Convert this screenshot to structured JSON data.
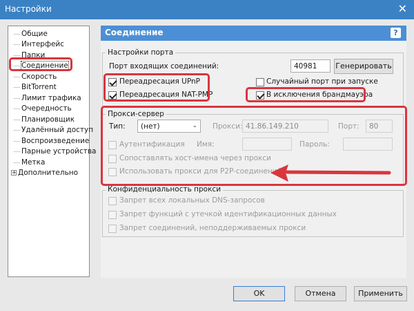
{
  "window": {
    "title": "Настройки",
    "close_glyph": "✕"
  },
  "sidebar": {
    "items": [
      {
        "label": "Общие"
      },
      {
        "label": "Интерфейс"
      },
      {
        "label": "Папки"
      },
      {
        "label": "Соединение",
        "selected": true
      },
      {
        "label": "Скорость"
      },
      {
        "label": "BitTorrent"
      },
      {
        "label": "Лимит трафика"
      },
      {
        "label": "Очередность"
      },
      {
        "label": "Планировщик"
      },
      {
        "label": "Удалённый доступ"
      },
      {
        "label": "Воспроизведение"
      },
      {
        "label": "Парные устройства"
      },
      {
        "label": "Метка"
      },
      {
        "label": "Дополнительно",
        "expandable": true
      }
    ],
    "expander_glyph": "+"
  },
  "header": {
    "title": "Соединение",
    "help_glyph": "?"
  },
  "port_settings": {
    "group_title": "Настройки порта",
    "incoming_port_label": "Порт входящих соединений:",
    "incoming_port_value": "40981",
    "generate_button": "Генерировать",
    "upnp_label": "Переадресация UPnP",
    "upnp_checked": true,
    "natpmp_label": "Переадресация NAT-PMP",
    "natpmp_checked": true,
    "random_port_label": "Случайный порт при запуске",
    "random_port_checked": false,
    "firewall_label": "В исключения брандмауэра",
    "firewall_checked": true
  },
  "proxy": {
    "group_title": "Прокси-сервер",
    "type_label": "Тип:",
    "type_value": "(нет)",
    "proxy_label": "Прокси:",
    "proxy_value": "41.86.149.210",
    "port_label": "Порт:",
    "port_value": "80",
    "auth_label": "Аутентификация",
    "username_label": "Имя:",
    "password_label": "Пароль:",
    "resolve_label": "Сопоставлять хост-имена через прокси",
    "p2p_label": "Использовать прокси для P2P-соединений"
  },
  "privacy": {
    "group_title": "Конфиденциальность прокси",
    "items": [
      {
        "label": "Запрет всех локальных DNS-запросов"
      },
      {
        "label": "Запрет функций с утечкой идентификационных данных"
      },
      {
        "label": "Запрет соединений, неподдерживаемых прокси"
      }
    ]
  },
  "footer": {
    "ok": "OK",
    "cancel": "Отмена",
    "apply": "Применить"
  },
  "colors": {
    "highlight": "#d9363e",
    "titlebar": "#3b82c4",
    "header": "#4c8fd6"
  }
}
